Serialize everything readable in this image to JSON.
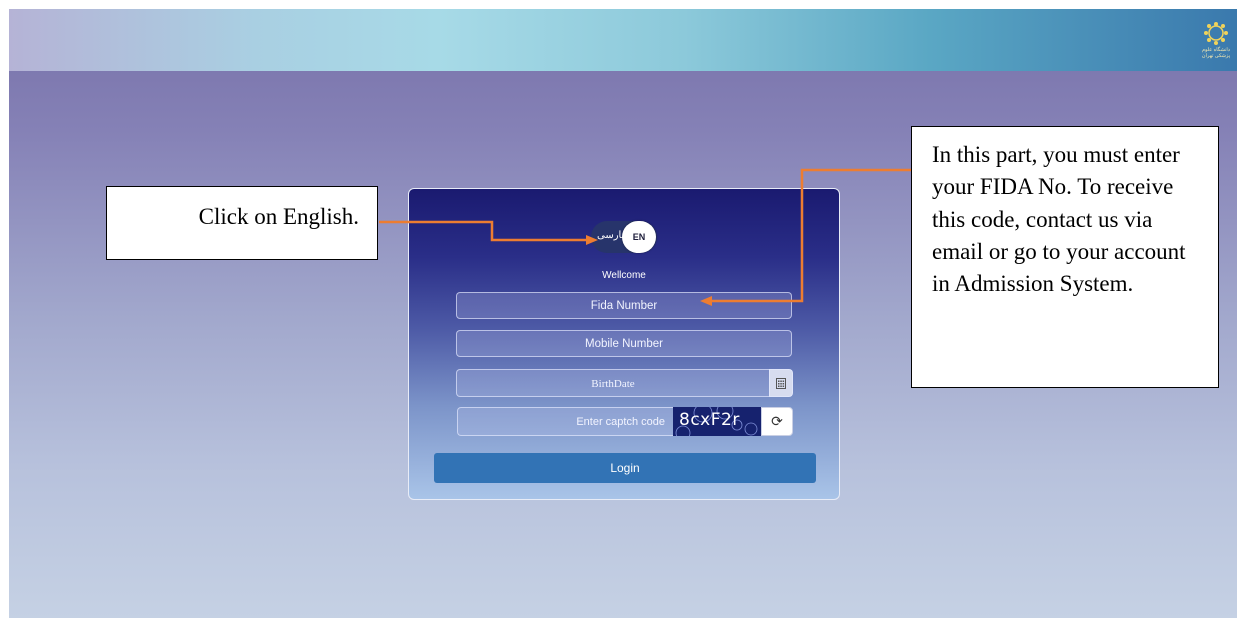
{
  "header": {
    "logo_icon": "university-logo-icon",
    "logo_text": "دانشگاه علوم پزشکی تهران"
  },
  "login": {
    "lang_persian": "فارسی",
    "lang_english": "EN",
    "welcome": "Wellcome",
    "fida_placeholder": "Fida Number",
    "mobile_placeholder": "Mobile Number",
    "birthdate_placeholder": "BirthDate",
    "calendar_icon": "calendar-icon",
    "captcha_placeholder": "Enter captch code",
    "captcha_code": "8cxF2r",
    "refresh_icon": "refresh-icon",
    "login_label": "Login"
  },
  "annotations": {
    "left_text": "Click on English.",
    "right_text": "In this part, you must enter your FIDA No. To receive this code, contact us via email or go to your account in Admission System.",
    "arrow_color": "#ed7d31"
  },
  "colors": {
    "primary_button": "#3273b5",
    "card_top": "#1a1a70",
    "card_bottom": "#a9c4e8"
  }
}
